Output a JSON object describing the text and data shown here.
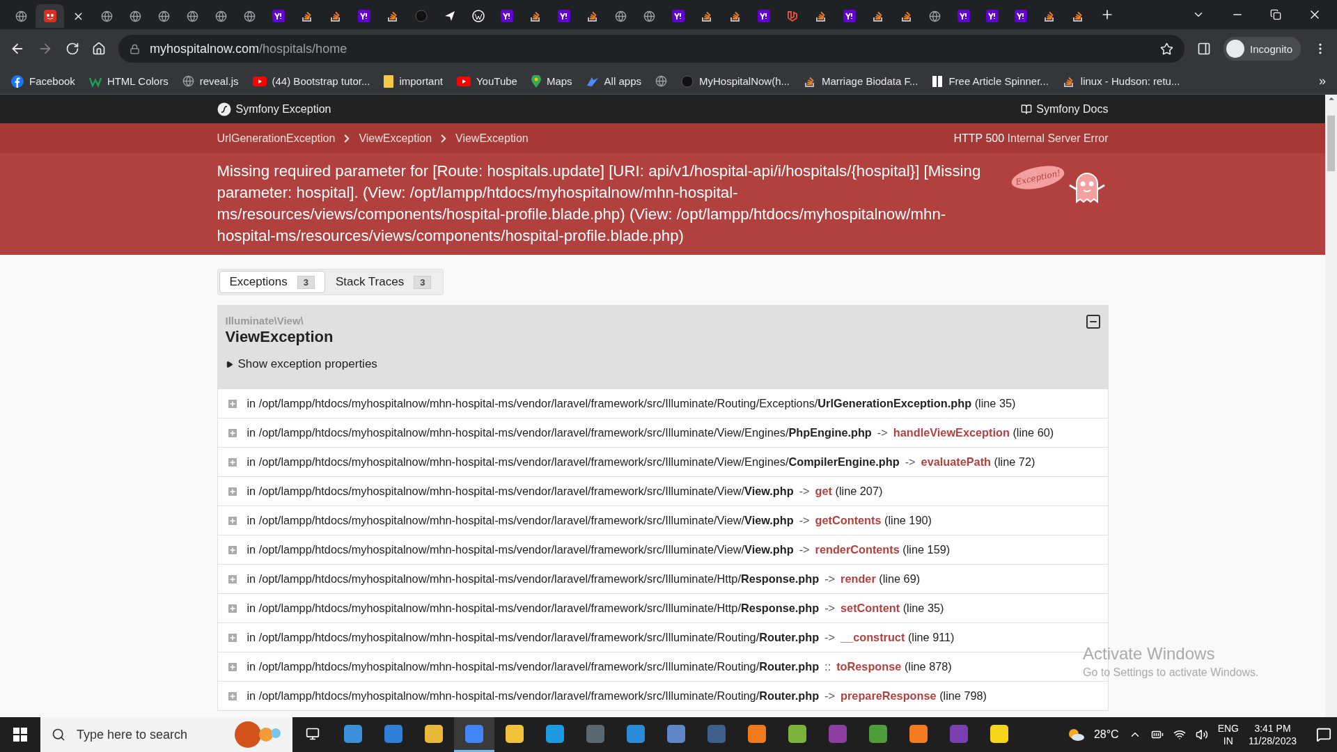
{
  "browser": {
    "tabs": [
      {
        "kind": "globe",
        "selected": false
      },
      {
        "kind": "mask",
        "selected": true
      },
      {
        "kind": "close",
        "selected": false
      },
      {
        "kind": "globe",
        "selected": false
      },
      {
        "kind": "globe",
        "selected": false
      },
      {
        "kind": "globe",
        "selected": false
      },
      {
        "kind": "globe",
        "selected": false
      },
      {
        "kind": "globe",
        "selected": false
      },
      {
        "kind": "globe",
        "selected": false
      },
      {
        "kind": "yahoo",
        "selected": false
      },
      {
        "kind": "stack",
        "selected": false
      },
      {
        "kind": "stack",
        "selected": false
      },
      {
        "kind": "yahoo",
        "selected": false
      },
      {
        "kind": "stack",
        "selected": false
      },
      {
        "kind": "github",
        "selected": false
      },
      {
        "kind": "send",
        "selected": false
      },
      {
        "kind": "wordpress",
        "selected": false
      },
      {
        "kind": "yahoo",
        "selected": false
      },
      {
        "kind": "stack",
        "selected": false
      },
      {
        "kind": "yahoo",
        "selected": false
      },
      {
        "kind": "stack",
        "selected": false
      },
      {
        "kind": "globe",
        "selected": false
      },
      {
        "kind": "globe",
        "selected": false
      },
      {
        "kind": "yahoo",
        "selected": false
      },
      {
        "kind": "stack",
        "selected": false
      },
      {
        "kind": "stack",
        "selected": false
      },
      {
        "kind": "yahoo",
        "selected": false
      },
      {
        "kind": "laravel",
        "selected": false
      },
      {
        "kind": "stack",
        "selected": false
      },
      {
        "kind": "yahoo",
        "selected": false
      },
      {
        "kind": "stack",
        "selected": false
      },
      {
        "kind": "stack",
        "selected": false
      },
      {
        "kind": "globe",
        "selected": false
      },
      {
        "kind": "yahoo",
        "selected": false
      },
      {
        "kind": "yahoo",
        "selected": false
      },
      {
        "kind": "yahoo",
        "selected": false
      },
      {
        "kind": "stack",
        "selected": false
      },
      {
        "kind": "stack",
        "selected": false
      }
    ],
    "address": {
      "host": "myhospitalnow.com",
      "path": "/hospitals/home"
    },
    "profile": "Incognito",
    "bookmarks": [
      {
        "kind": "facebook",
        "label": "Facebook"
      },
      {
        "kind": "w",
        "label": "HTML Colors"
      },
      {
        "kind": "globe",
        "label": "reveal.js"
      },
      {
        "kind": "youtube",
        "label": "(44) Bootstrap tutor..."
      },
      {
        "kind": "folder",
        "label": "important"
      },
      {
        "kind": "youtube",
        "label": "YouTube"
      },
      {
        "kind": "pin",
        "label": "Maps"
      },
      {
        "kind": "apps",
        "label": "All apps"
      },
      {
        "kind": "globe"
      },
      {
        "kind": "github",
        "label": "MyHospitalNow(h..."
      },
      {
        "kind": "stack",
        "label": "Marriage Biodata F..."
      },
      {
        "kind": "doc",
        "label": "Free Article Spinner..."
      },
      {
        "kind": "stack",
        "label": "linux - Hudson: retu..."
      }
    ],
    "more_bookmarks": "»"
  },
  "page": {
    "header": {
      "title": "Symfony Exception",
      "docs": "Symfony Docs"
    },
    "breadcrumbs": [
      "UrlGenerationException",
      "ViewException",
      "ViewException"
    ],
    "status": {
      "code": "HTTP 500",
      "text": "Internal Server Error"
    },
    "message": "Missing required parameter for [Route: hospitals.update] [URI: api/v1/hospital-api/i/hospitals/{hospital}] [Missing parameter: hospital]. (View: /opt/lampp/htdocs/myhospitalnow/mhn-hospital-ms/resources/views/components/hospital-profile.blade.php) (View: /opt/lampp/htdocs/myhospitalnow/mhn-hospital-ms/resources/views/components/hospital-profile.blade.php)",
    "ghost_bubble": "Exception!",
    "tabs": [
      {
        "label": "Exceptions",
        "count": "3",
        "selected": true
      },
      {
        "label": "Stack Traces",
        "count": "3",
        "selected": false
      }
    ],
    "exception": {
      "namespace": "Illuminate\\View\\",
      "name": "ViewException",
      "properties_label": "Show exception properties",
      "expanded": false,
      "traces": [
        {
          "path": "in /opt/lampp/htdocs/myhospitalnow/mhn-hospital-ms/vendor/laravel/framework/src/Illuminate/Routing/Exceptions/",
          "file": "UrlGenerationException.php",
          "line": "(line 35)"
        },
        {
          "path": "in /opt/lampp/htdocs/myhospitalnow/mhn-hospital-ms/vendor/laravel/framework/src/Illuminate/View/Engines/",
          "file": "PhpEngine.php",
          "sep": "->",
          "method": "handleViewException",
          "line": "(line 60)"
        },
        {
          "path": "in /opt/lampp/htdocs/myhospitalnow/mhn-hospital-ms/vendor/laravel/framework/src/Illuminate/View/Engines/",
          "file": "CompilerEngine.php",
          "sep": "->",
          "method": "evaluatePath",
          "line": "(line 72)"
        },
        {
          "path": "in /opt/lampp/htdocs/myhospitalnow/mhn-hospital-ms/vendor/laravel/framework/src/Illuminate/View/",
          "file": "View.php",
          "sep": "->",
          "method": "get",
          "line": "(line 207)"
        },
        {
          "path": "in /opt/lampp/htdocs/myhospitalnow/mhn-hospital-ms/vendor/laravel/framework/src/Illuminate/View/",
          "file": "View.php",
          "sep": "->",
          "method": "getContents",
          "line": "(line 190)"
        },
        {
          "path": "in /opt/lampp/htdocs/myhospitalnow/mhn-hospital-ms/vendor/laravel/framework/src/Illuminate/View/",
          "file": "View.php",
          "sep": "->",
          "method": "renderContents",
          "line": "(line 159)"
        },
        {
          "path": "in /opt/lampp/htdocs/myhospitalnow/mhn-hospital-ms/vendor/laravel/framework/src/Illuminate/Http/",
          "file": "Response.php",
          "sep": "->",
          "method": "render",
          "line": "(line 69)"
        },
        {
          "path": "in /opt/lampp/htdocs/myhospitalnow/mhn-hospital-ms/vendor/laravel/framework/src/Illuminate/Http/",
          "file": "Response.php",
          "sep": "->",
          "method": "setContent",
          "line": "(line 35)"
        },
        {
          "path": "in /opt/lampp/htdocs/myhospitalnow/mhn-hospital-ms/vendor/laravel/framework/src/Illuminate/Routing/",
          "file": "Router.php",
          "sep": "->",
          "method": "__construct",
          "line": "(line 911)"
        },
        {
          "path": "in /opt/lampp/htdocs/myhospitalnow/mhn-hospital-ms/vendor/laravel/framework/src/Illuminate/Routing/",
          "file": "Router.php",
          "sep": "::",
          "method": "toResponse",
          "line": "(line 878)"
        },
        {
          "path": "in /opt/lampp/htdocs/myhospitalnow/mhn-hospital-ms/vendor/laravel/framework/src/Illuminate/Routing/",
          "file": "Router.php",
          "sep": "->",
          "method": "prepareResponse",
          "line": "(line 798)"
        }
      ]
    }
  },
  "os_notice": {
    "title": "Activate Windows",
    "subtitle": "Go to Settings to activate Windows."
  },
  "taskbar": {
    "search_placeholder": "Type here to search",
    "apps": [
      {
        "color": "#3b8ed8",
        "selected": false
      },
      {
        "color": "#2f7fd6",
        "selected": false
      },
      {
        "color": "#e8b93a",
        "selected": false
      },
      {
        "color": "#4285f4",
        "selected": true
      },
      {
        "color": "#f0c23b",
        "selected": false
      },
      {
        "color": "#1e9be0",
        "selected": false
      },
      {
        "color": "#5a6770",
        "selected": false
      },
      {
        "color": "#2a8bd8",
        "selected": false
      },
      {
        "color": "#5f86c8",
        "selected": false
      },
      {
        "color": "#3f5f8c",
        "selected": false
      },
      {
        "color": "#f07b1d",
        "selected": false
      },
      {
        "color": "#7bb33c",
        "selected": false
      },
      {
        "color": "#8c3fa0",
        "selected": false
      },
      {
        "color": "#4e9d3a",
        "selected": false
      },
      {
        "color": "#f57b20",
        "selected": false
      },
      {
        "color": "#7a3fb0",
        "selected": false
      },
      {
        "color": "#f7d51d",
        "selected": false
      }
    ],
    "weather": "28°C",
    "language": "ENG",
    "region": "IN",
    "time": "3:41 PM",
    "date": "11/28/2023"
  }
}
